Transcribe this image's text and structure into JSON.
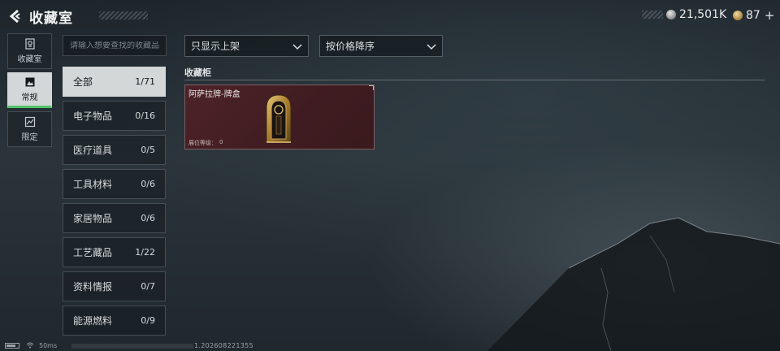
{
  "header": {
    "title": "收藏室",
    "currency_silver": "21,501K",
    "currency_gold": "87",
    "plus_label": "+"
  },
  "rail": {
    "items": [
      {
        "label": "收藏室",
        "icon": "trophy-icon"
      },
      {
        "label": "常规",
        "icon": "picture-icon"
      },
      {
        "label": "限定",
        "icon": "limited-icon"
      }
    ]
  },
  "search": {
    "placeholder": "请输入想要查找的收藏品"
  },
  "categories": [
    {
      "label": "全部",
      "count": "1/71"
    },
    {
      "label": "电子物品",
      "count": "0/16"
    },
    {
      "label": "医疗道具",
      "count": "0/5"
    },
    {
      "label": "工具材料",
      "count": "0/6"
    },
    {
      "label": "家居物品",
      "count": "0/6"
    },
    {
      "label": "工艺藏品",
      "count": "1/22"
    },
    {
      "label": "资料情报",
      "count": "0/7"
    },
    {
      "label": "能源燃料",
      "count": "0/9"
    }
  ],
  "filters": {
    "shelf_filter": "只显示上架",
    "sort_order": "按价格降序"
  },
  "cabinet": {
    "title": "收藏柜",
    "items": [
      {
        "name": "阿萨拉牌-牌盒",
        "level_label": "展位等级：",
        "level_value": "0"
      }
    ]
  },
  "footer": {
    "ping": "50ms",
    "build": "1.202608221355"
  },
  "colors": {
    "accent_green": "#53c46b",
    "card_bg": "#4d2328",
    "active_bg": "#d4d7d8"
  }
}
